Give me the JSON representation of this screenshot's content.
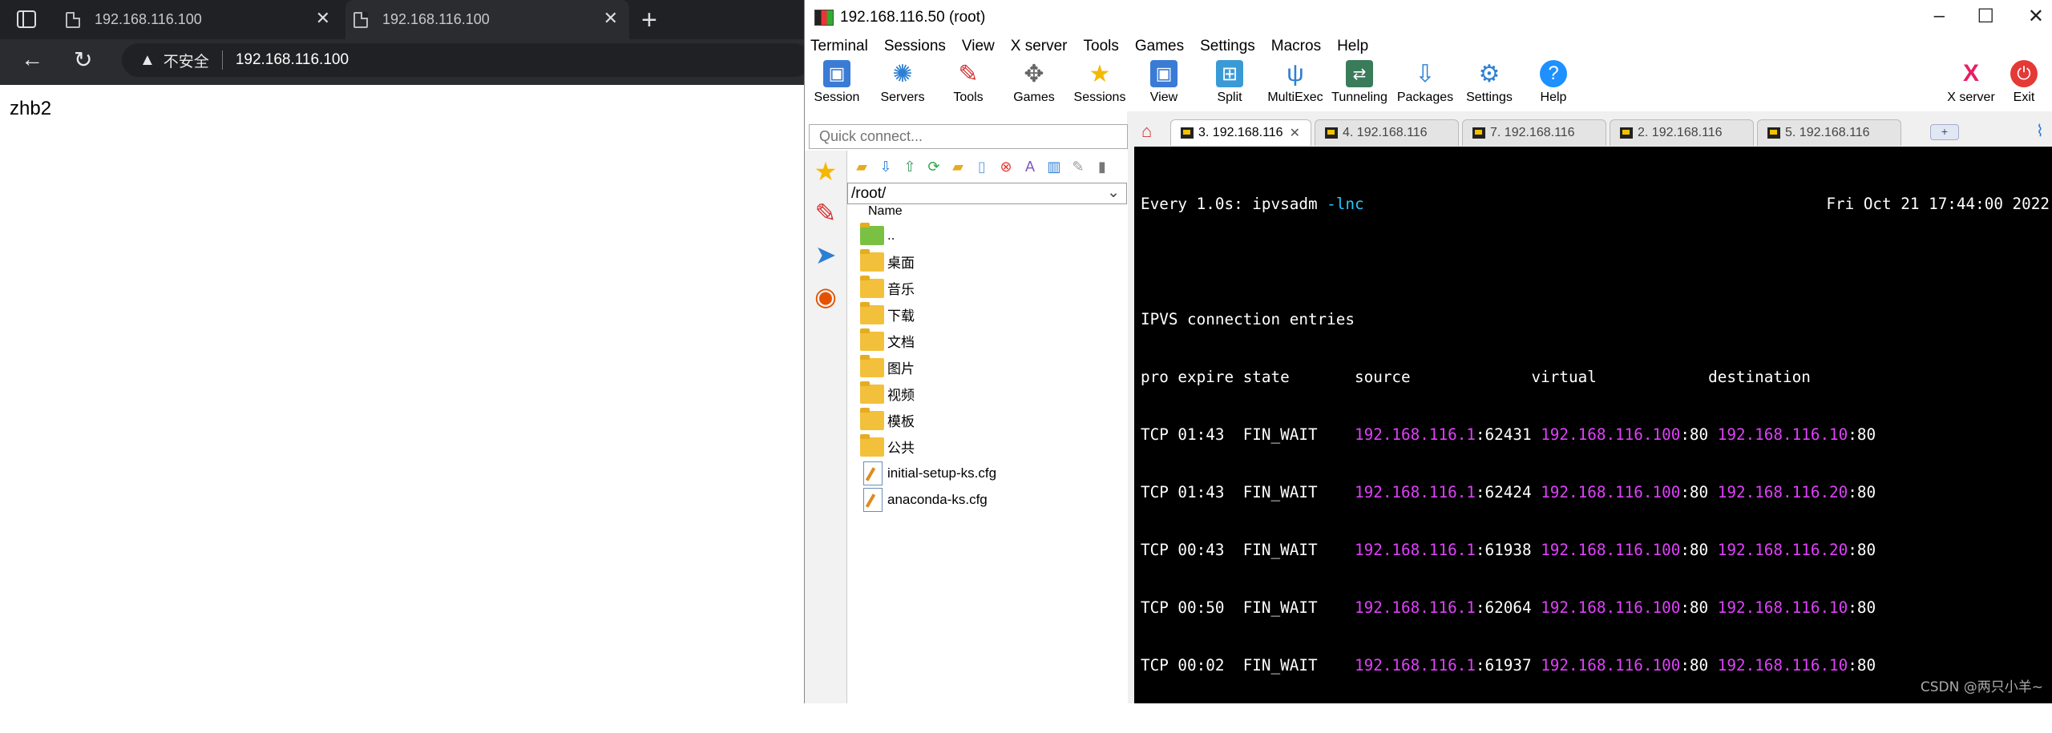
{
  "browser": {
    "tabs": [
      {
        "title": "192.168.116.100"
      },
      {
        "title": "192.168.116.100"
      }
    ],
    "address": {
      "security_label": "不安全",
      "url": "192.168.116.100"
    },
    "page_content": "zhb2"
  },
  "mobaxterm": {
    "window_title": "192.168.116.50 (root)",
    "menu": [
      "Terminal",
      "Sessions",
      "View",
      "X server",
      "Tools",
      "Games",
      "Settings",
      "Macros",
      "Help"
    ],
    "toolbar": {
      "session": "Session",
      "servers": "Servers",
      "tools": "Tools",
      "games": "Games",
      "sessions": "Sessions",
      "view": "View",
      "split": "Split",
      "multiexec": "MultiExec",
      "tunneling": "Tunneling",
      "packages": "Packages",
      "settings": "Settings",
      "help": "Help",
      "xserver": "X server",
      "exit": "Exit"
    },
    "quick_connect_placeholder": "Quick connect...",
    "sftp": {
      "path": "/root/",
      "column": "Name",
      "files": [
        "..",
        "桌面",
        "音乐",
        "下载",
        "文档",
        "图片",
        "视频",
        "模板",
        "公共",
        "initial-setup-ks.cfg",
        "anaconda-ks.cfg"
      ]
    },
    "session_tabs": [
      "3. 192.168.116",
      "4. 192.168.116",
      "7. 192.168.116",
      "2. 192.168.116",
      "5. 192.168.116"
    ],
    "terminal": {
      "watch_prefix": "Every 1.0s: ipvsadm ",
      "watch_flag": "-lnc",
      "datetime": "Fri Oct 21 17:44:00 2022",
      "heading": "IPVS connection entries",
      "header_row": "pro expire state       source             virtual            destination",
      "rows": [
        {
          "pre": "TCP 01:43  FIN_WAIT    ",
          "src": "192.168.116.1",
          "sport": ":62431 ",
          "vip": "192.168.116.100",
          "vport": ":80 ",
          "dst": "192.168.116.10",
          "dport": ":80"
        },
        {
          "pre": "TCP 01:43  FIN_WAIT    ",
          "src": "192.168.116.1",
          "sport": ":62424 ",
          "vip": "192.168.116.100",
          "vport": ":80 ",
          "dst": "192.168.116.20",
          "dport": ":80"
        },
        {
          "pre": "TCP 00:43  FIN_WAIT    ",
          "src": "192.168.116.1",
          "sport": ":61938 ",
          "vip": "192.168.116.100",
          "vport": ":80 ",
          "dst": "192.168.116.20",
          "dport": ":80"
        },
        {
          "pre": "TCP 00:50  FIN_WAIT    ",
          "src": "192.168.116.1",
          "sport": ":62064 ",
          "vip": "192.168.116.100",
          "vport": ":80 ",
          "dst": "192.168.116.10",
          "dport": ":80"
        },
        {
          "pre": "TCP 00:02  FIN_WAIT    ",
          "src": "192.168.116.1",
          "sport": ":61937 ",
          "vip": "192.168.116.100",
          "vport": ":80 ",
          "dst": "192.168.116.10",
          "dport": ":80"
        }
      ]
    },
    "watermark": "CSDN @两只小羊~"
  }
}
